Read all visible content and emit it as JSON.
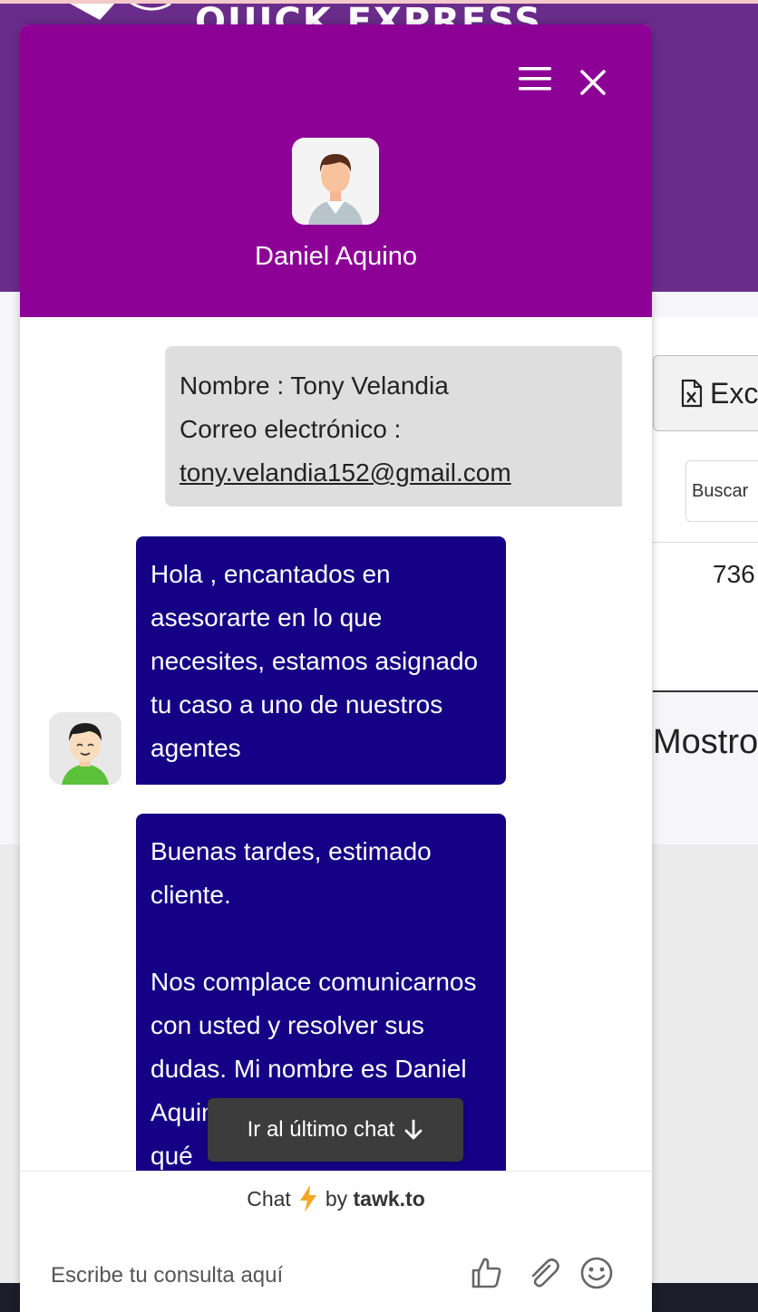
{
  "site": {
    "logo_text": "QUICK EXPRESS",
    "export_button_label": "Exc",
    "search_placeholder": "Buscar",
    "table_cell": "736",
    "footer_text": "Mostro"
  },
  "chat": {
    "agent_name": "Daniel Aquino",
    "visitor_message": {
      "name_line": "Nombre : Tony Velandia",
      "email_label": "Correo electrónico :",
      "email": "tony.velandia152@gmail.com"
    },
    "agent_messages": [
      {
        "text": "Hola , encantados en asesorartе en lo que necesites, estamos asignado tu caso a uno de nuestros agentes"
      },
      {
        "paragraphs": [
          "Buenas tardes, estimado cliente.",
          "Nos complace comunicarnos con usted y resolver sus dudas. Mi nombre es Daniel Aquino de Quickex.net ¿en qué"
        ]
      }
    ],
    "jump_button_label": "Ir al último chat",
    "branding": {
      "prefix": "Chat",
      "by": "by",
      "brand": "tawk.to"
    },
    "composer": {
      "placeholder": "Escribe tu consulta aquí"
    },
    "icons": {
      "menu": "menu-icon",
      "close": "close-icon",
      "like": "thumbs-up-icon",
      "attach": "paperclip-icon",
      "emoji": "smiley-icon",
      "arrow": "arrow-down-icon",
      "bolt": "lightning-icon"
    },
    "colors": {
      "header": "#8d0096",
      "agent_bubble": "#160085",
      "visitor_bubble": "#dedede",
      "site_header": "#6a2c8a"
    }
  }
}
